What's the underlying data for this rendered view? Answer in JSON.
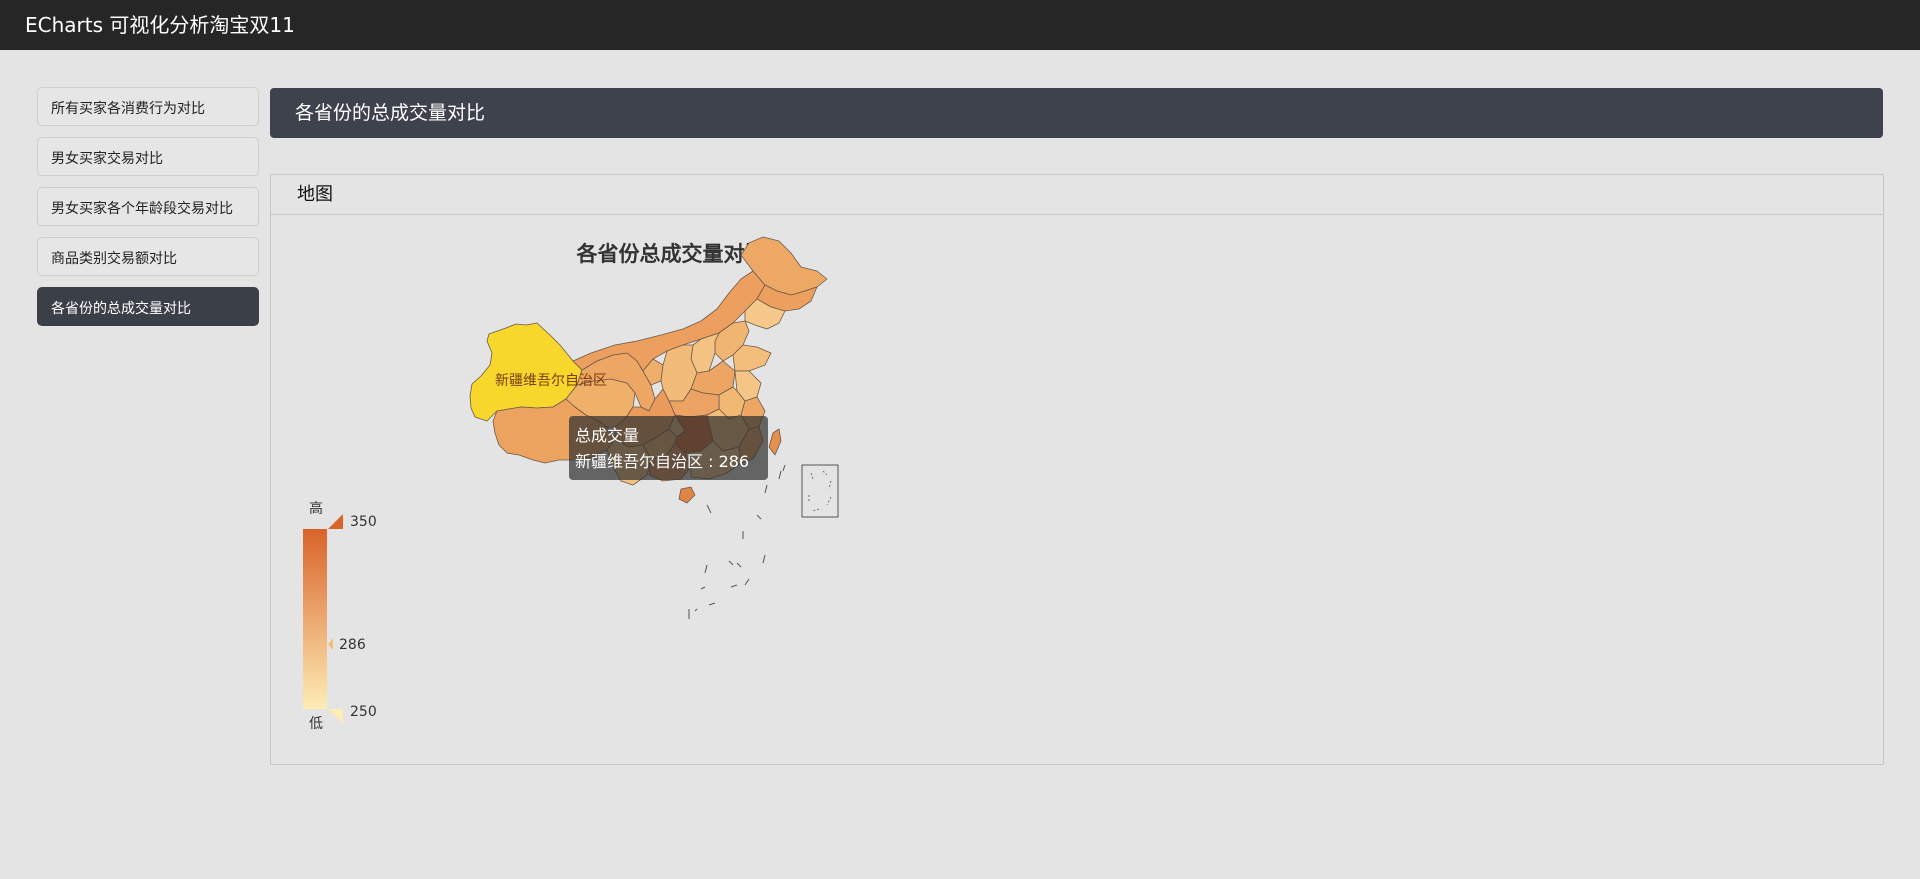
{
  "app": {
    "title": "ECharts 可视化分析淘宝双11"
  },
  "sidebar": {
    "items": [
      {
        "label": "所有买家各消费行为对比",
        "active": false
      },
      {
        "label": "男女买家交易对比",
        "active": false
      },
      {
        "label": "男女买家各个年龄段交易对比",
        "active": false
      },
      {
        "label": "商品类别交易额对比",
        "active": false
      },
      {
        "label": "各省份的总成交量对比",
        "active": true
      }
    ]
  },
  "page": {
    "header": "各省份的总成交量对比"
  },
  "panel": {
    "title": "地图"
  },
  "chart_data": {
    "type": "map",
    "title": "各省份总成交量对比",
    "series_name": "总成交量",
    "visual_map": {
      "min": 250,
      "max": 350,
      "text_high": "高",
      "text_low": "低",
      "max_label": "350",
      "min_label": "250",
      "indicator_label": "286",
      "indicator_value": 286,
      "color_low": "#fdedb5",
      "color_high": "#d9632a"
    },
    "highlighted": {
      "name": "新疆维吾尔自治区",
      "value": 286,
      "color": "#f7d72c"
    },
    "tooltip": {
      "title": "总成交量",
      "line": "新疆维吾尔自治区 : 286"
    }
  }
}
